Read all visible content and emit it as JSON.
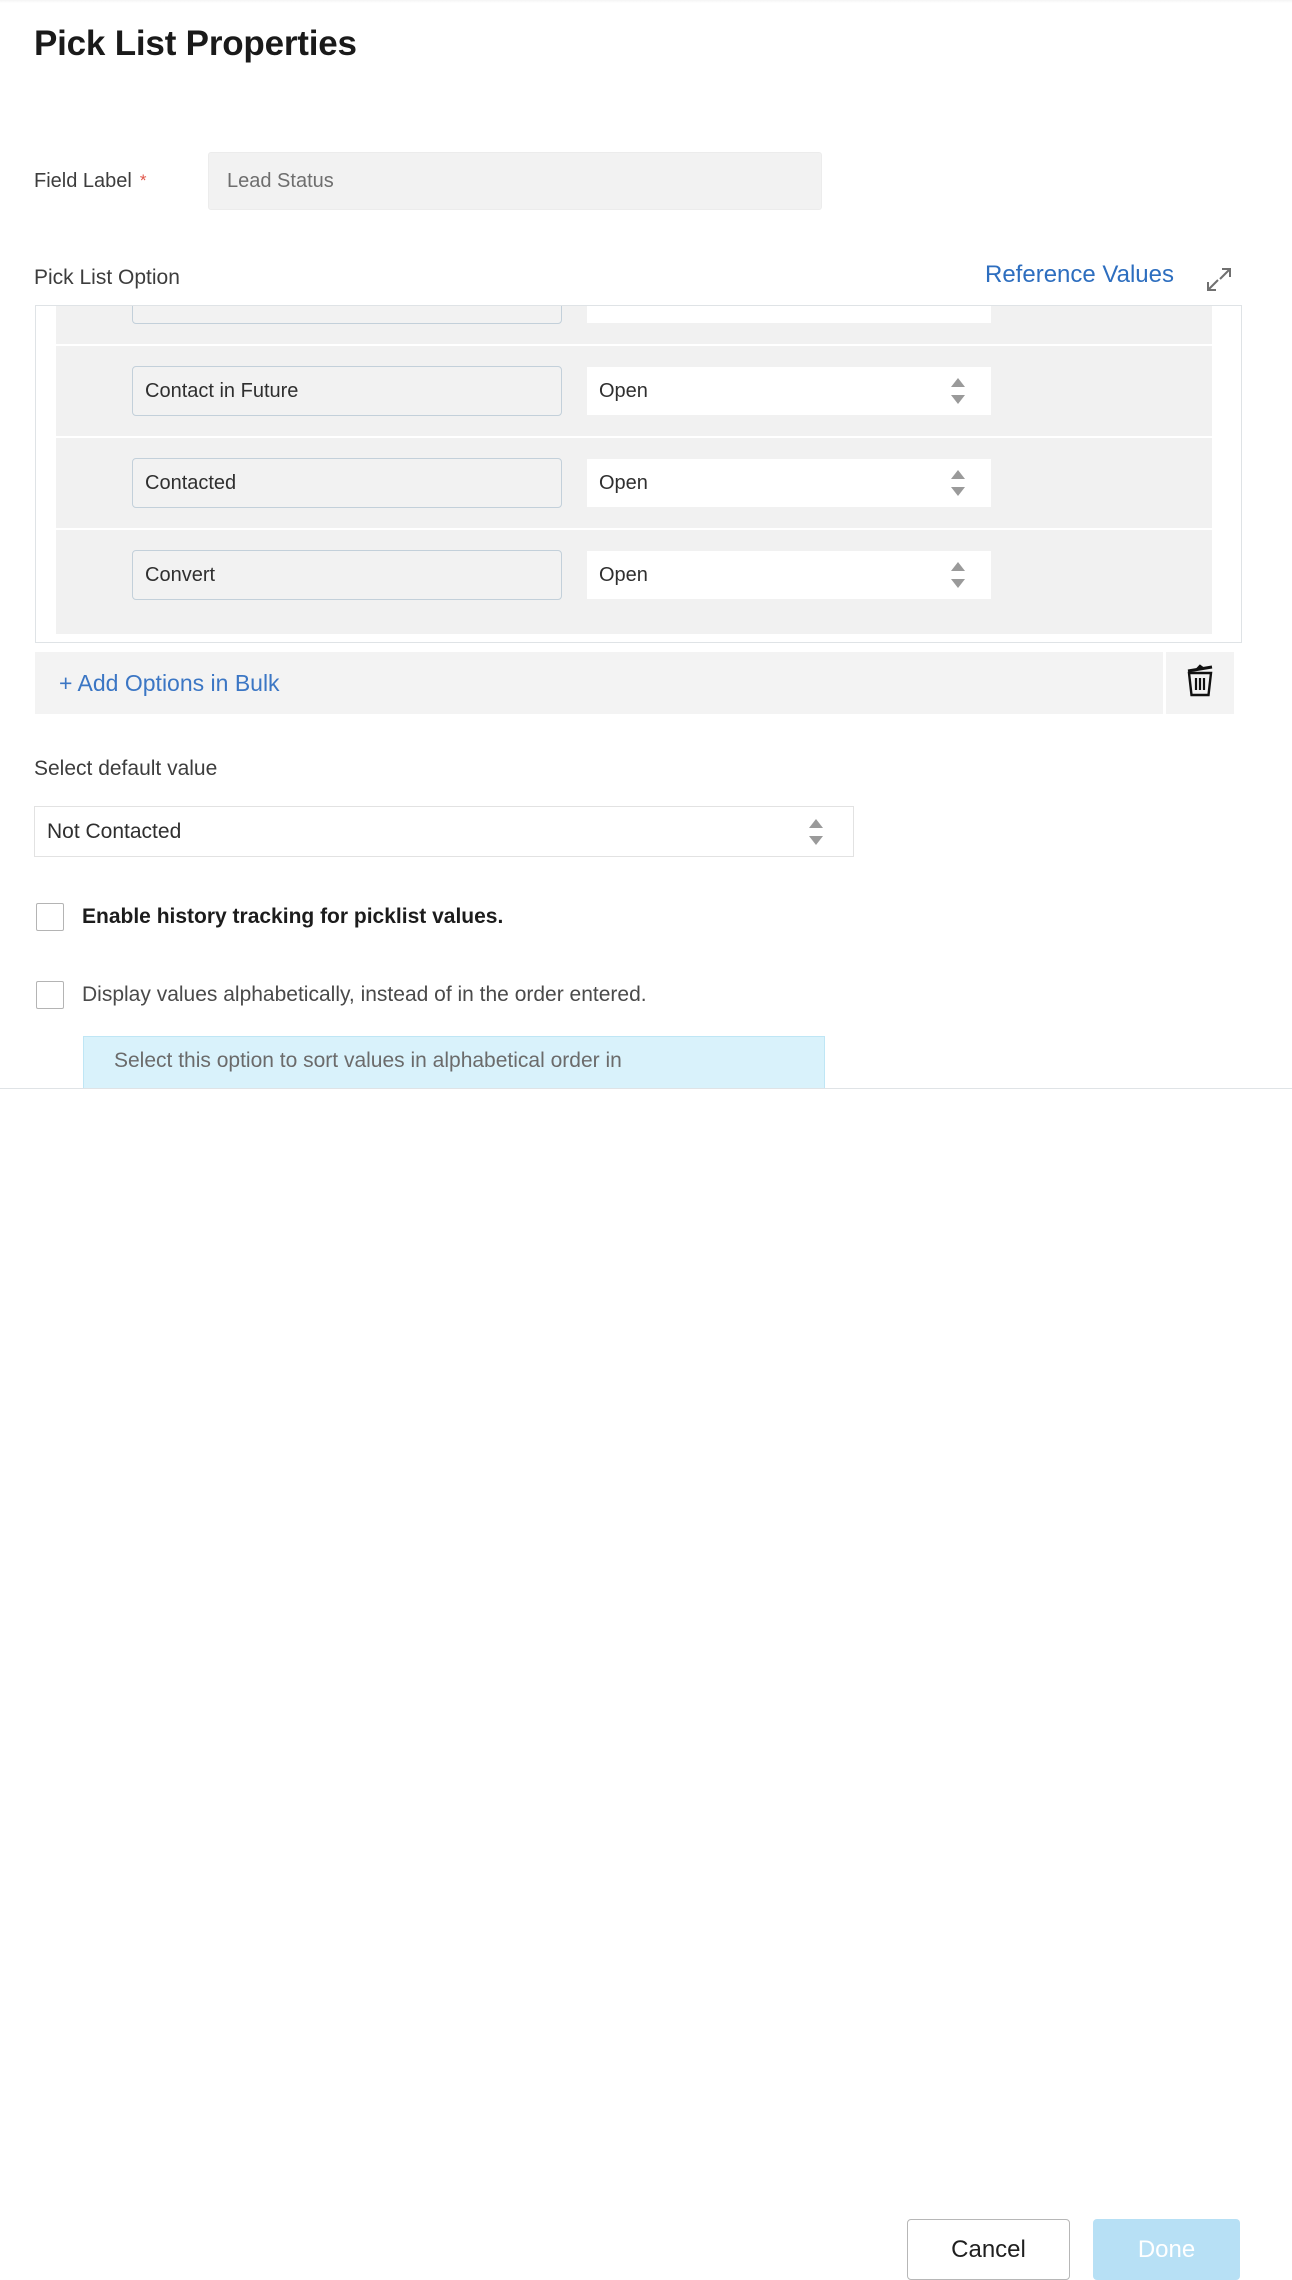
{
  "page": {
    "title": "Pick List Properties"
  },
  "field_label": {
    "label": "Field Label",
    "required_marker": "*",
    "value": "Lead Status",
    "placeholder": "Lead Status"
  },
  "picklist": {
    "section_label": "Pick List Option",
    "reference_values_link": "Reference Values",
    "expand_icon": "expand-diagonal-icon",
    "column_status_default": "Open",
    "rows": [
      {
        "name": "",
        "status": "",
        "clipped": true
      },
      {
        "name": "Contact in Future",
        "status": "Open",
        "clipped": false
      },
      {
        "name": "Contacted",
        "status": "Open",
        "clipped": false
      },
      {
        "name": "Convert",
        "status": "Open",
        "clipped": false
      }
    ]
  },
  "bulk": {
    "add_link": "+ Add Options in Bulk",
    "delete_icon": "trash-icon"
  },
  "default_value": {
    "label": "Select default value",
    "value": "Not Contacted"
  },
  "options": {
    "history_tracking_label": "Enable history tracking for picklist values.",
    "history_tracking_checked": false,
    "alphabetical_label": "Display values alphabetically, instead of in the order entered.",
    "alphabetical_checked": false,
    "tooltip_text": "Select this option to sort values in alphabetical order in"
  },
  "footer": {
    "cancel_label": "Cancel",
    "done_label": "Done"
  },
  "colors": {
    "link_blue": "#3b76c4",
    "reference_blue": "#2d6ebf",
    "required_red": "#e0564a",
    "done_disabled": "#b7e0f5",
    "tooltip_bg": "#d9f2fb"
  }
}
